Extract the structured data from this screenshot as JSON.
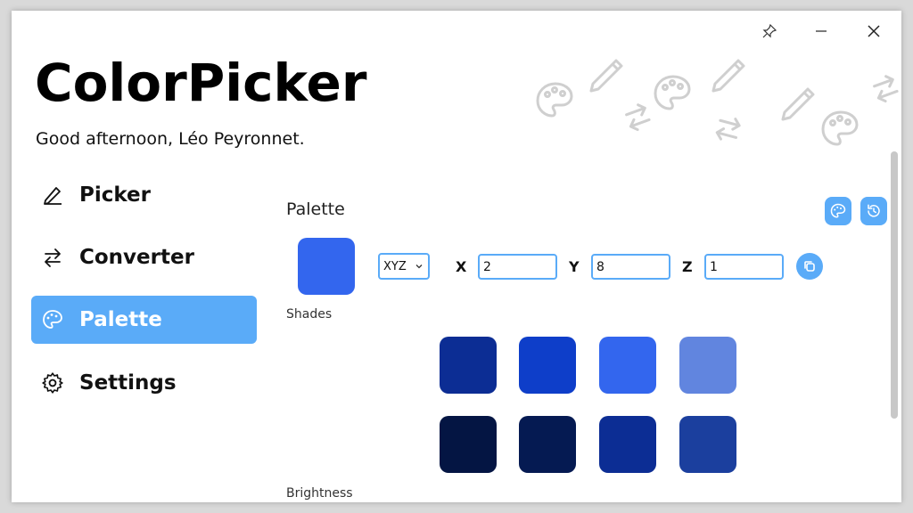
{
  "app": {
    "title": "ColorPicker",
    "greeting": "Good afternoon, Léo Peyronnet."
  },
  "titlebar": {
    "pin_icon": "pin-icon",
    "minimize_icon": "minimize-icon",
    "close_icon": "close-icon"
  },
  "nav": {
    "items": [
      {
        "label": "Picker",
        "icon": "pen-icon",
        "active": false
      },
      {
        "label": "Converter",
        "icon": "swap-arrows-icon",
        "active": false
      },
      {
        "label": "Palette",
        "icon": "palette-icon",
        "active": true
      },
      {
        "label": "Settings",
        "icon": "gear-icon",
        "active": false
      }
    ]
  },
  "palette": {
    "section_title": "Palette",
    "preview_color": "#3366ee",
    "color_space": "XYZ",
    "x_label": "X",
    "y_label": "Y",
    "z_label": "Z",
    "x_value": "2",
    "y_value": "8",
    "z_value": "1",
    "shades_label": "Shades",
    "brightness_label": "Brightness",
    "shades": [
      [
        "#0c2d94",
        "#0e3ec9",
        "#3366ee",
        "#6185df"
      ],
      [
        "#041543",
        "#051a52",
        "#0c2d94",
        "#1b3f9e"
      ]
    ]
  },
  "colors": {
    "accent": "#5aabf8",
    "nav_active_text": "#ffffff"
  }
}
